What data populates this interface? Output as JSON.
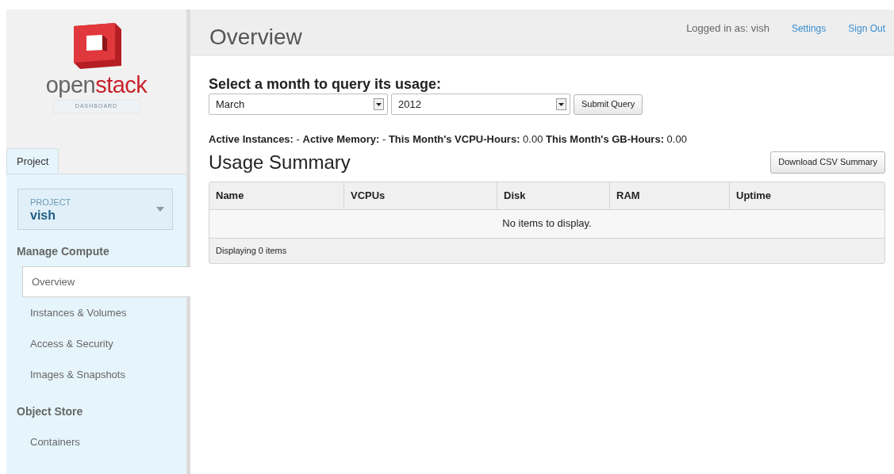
{
  "logo": {
    "text_dark": "open",
    "text_red": "stack",
    "subtitle": "DASHBOARD"
  },
  "sidebar": {
    "tabs": [
      {
        "label": "Project",
        "selected": true
      }
    ],
    "project_switcher": {
      "label": "PROJECT",
      "value": "vish"
    },
    "groups": [
      {
        "title": "Manage Compute",
        "items": [
          {
            "label": "Overview",
            "selected": true
          },
          {
            "label": "Instances & Volumes",
            "selected": false
          },
          {
            "label": "Access & Security",
            "selected": false
          },
          {
            "label": "Images & Snapshots",
            "selected": false
          }
        ]
      },
      {
        "title": "Object Store",
        "items": [
          {
            "label": "Containers",
            "selected": false
          }
        ]
      }
    ]
  },
  "header": {
    "title": "Overview",
    "user": "Logged in as: vish",
    "links": [
      "Settings",
      "Sign Out"
    ]
  },
  "query": {
    "heading": "Select a month to query its usage:",
    "month": "March",
    "year": "2012",
    "button": "Submit Query"
  },
  "stats": "**Active Instances:** - **Active Memory:** - **This Month's VCPU-Hours:** 0.00 **This Month's GB-Hours:** 0.00",
  "usage": {
    "title": "Usage Summary",
    "download_button": "Download CSV Summary",
    "columns": [
      "Name",
      "VCPUs",
      "Disk",
      "RAM",
      "Uptime"
    ],
    "empty_message": "No items to display.",
    "footer": "Displaying 0 items"
  }
}
